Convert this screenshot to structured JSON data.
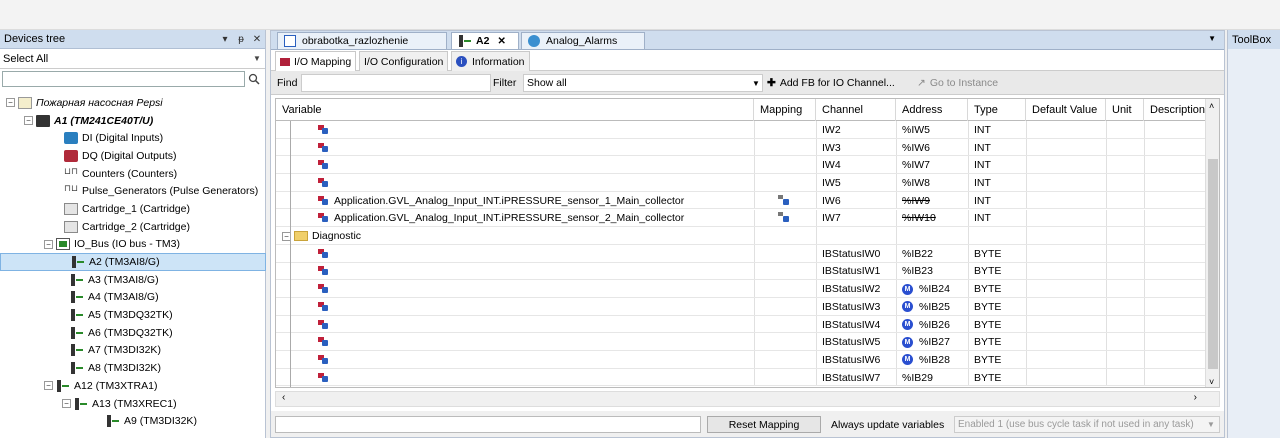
{
  "devices_panel": {
    "title": "Devices tree",
    "pin_icon": "pin-icon",
    "filter_value": "Select All",
    "tree": [
      {
        "label": "Пожарная насосная Pepsi",
        "level": 0,
        "icon": "project-icon",
        "toggle": "−"
      },
      {
        "label": "A1 (TM241CE40T/U)",
        "level": 1,
        "icon": "plc-icon",
        "toggle": "−"
      },
      {
        "label": "DI (Digital Inputs)",
        "level": 2,
        "icon": "di-icon"
      },
      {
        "label": "DQ (Digital Outputs)",
        "level": 2,
        "icon": "dq-icon"
      },
      {
        "label": "Counters (Counters)",
        "level": 2,
        "icon": "counter-icon"
      },
      {
        "label": "Pulse_Generators (Pulse Generators)",
        "level": 2,
        "icon": "pulse-icon"
      },
      {
        "label": "Cartridge_1 (Cartridge)",
        "level": 2,
        "icon": "cartridge-icon"
      },
      {
        "label": "Cartridge_2 (Cartridge)",
        "level": 2,
        "icon": "cartridge-icon"
      },
      {
        "label": "IO_Bus (IO bus - TM3)",
        "level": 2,
        "icon": "bus-icon",
        "toggle": "−"
      },
      {
        "label": "A2 (TM3AI8/G)",
        "level": 3,
        "icon": "module-icon",
        "selected": true
      },
      {
        "label": "A3 (TM3AI8/G)",
        "level": 3,
        "icon": "module-icon"
      },
      {
        "label": "A4 (TM3AI8/G)",
        "level": 3,
        "icon": "module-icon"
      },
      {
        "label": "A5 (TM3DQ32TK)",
        "level": 3,
        "icon": "module-icon"
      },
      {
        "label": "A6 (TM3DQ32TK)",
        "level": 3,
        "icon": "module-icon"
      },
      {
        "label": "A7 (TM3DI32K)",
        "level": 3,
        "icon": "module-icon"
      },
      {
        "label": "A8 (TM3DI32K)",
        "level": 3,
        "icon": "module-icon"
      },
      {
        "label": "A12 (TM3XTRA1)",
        "level": 3,
        "icon": "module-icon",
        "toggle": "−"
      },
      {
        "label": "A13 (TM3XREC1)",
        "level": 4,
        "icon": "module-icon",
        "toggle": "−"
      },
      {
        "label": "A9 (TM3DI32K)",
        "level": 5,
        "icon": "module-icon"
      }
    ]
  },
  "editor": {
    "tabs": [
      {
        "label": "obrabotka_razlozhenie",
        "active": false
      },
      {
        "label": "A2",
        "active": true,
        "close": "✕"
      },
      {
        "label": "Analog_Alarms",
        "active": false
      }
    ],
    "subtabs": [
      {
        "label": "I/O Mapping",
        "active": true
      },
      {
        "label": "I/O Configuration",
        "active": false
      },
      {
        "label": "Information",
        "active": false
      }
    ],
    "filterbar": {
      "find_label": "Find",
      "filter_label": "Filter",
      "filter_value": "Show all",
      "add_fb_label": "Add FB for IO Channel...",
      "goto_label": "Go to Instance"
    },
    "columns": [
      "Variable",
      "Mapping",
      "Channel",
      "Address",
      "Type",
      "Default Value",
      "Unit",
      "Description"
    ],
    "rows": [
      {
        "variable": "",
        "mapping": false,
        "channel": "IW2",
        "address": "%IW5",
        "type": "INT"
      },
      {
        "variable": "",
        "mapping": false,
        "channel": "IW3",
        "address": "%IW6",
        "type": "INT"
      },
      {
        "variable": "",
        "mapping": false,
        "channel": "IW4",
        "address": "%IW7",
        "type": "INT"
      },
      {
        "variable": "",
        "mapping": false,
        "channel": "IW5",
        "address": "%IW8",
        "type": "INT"
      },
      {
        "variable": "Application.GVL_Analog_Input_INT.iPRESSURE_sensor_1_Main_collector",
        "mapping": true,
        "channel": "IW6",
        "address": "%IW9",
        "strike": true,
        "type": "INT"
      },
      {
        "variable": "Application.GVL_Analog_Input_INT.iPRESSURE_sensor_2_Main_collector",
        "mapping": true,
        "channel": "IW7",
        "address": "%IW10",
        "strike": true,
        "type": "INT"
      },
      {
        "variable": "Diagnostic",
        "folder": true,
        "channel": "",
        "address": "",
        "type": ""
      },
      {
        "variable": "",
        "mapping": false,
        "channel": "IBStatusIW0",
        "address": "%IB22",
        "type": "BYTE"
      },
      {
        "variable": "",
        "mapping": false,
        "channel": "IBStatusIW1",
        "address": "%IB23",
        "type": "BYTE"
      },
      {
        "variable": "",
        "mapping": false,
        "channel": "IBStatusIW2",
        "address": "%IB24",
        "badge": true,
        "type": "BYTE"
      },
      {
        "variable": "",
        "mapping": false,
        "channel": "IBStatusIW3",
        "address": "%IB25",
        "badge": true,
        "type": "BYTE"
      },
      {
        "variable": "",
        "mapping": false,
        "channel": "IBStatusIW4",
        "address": "%IB26",
        "badge": true,
        "type": "BYTE"
      },
      {
        "variable": "",
        "mapping": false,
        "channel": "IBStatusIW5",
        "address": "%IB27",
        "badge": true,
        "type": "BYTE"
      },
      {
        "variable": "",
        "mapping": false,
        "channel": "IBStatusIW6",
        "address": "%IB28",
        "badge": true,
        "type": "BYTE"
      },
      {
        "variable": "",
        "mapping": false,
        "channel": "IBStatusIW7",
        "address": "%IB29",
        "type": "BYTE"
      }
    ],
    "badge_letter": "M",
    "bottom": {
      "reset_label": "Reset Mapping",
      "always_update_label": "Always update variables",
      "always_update_value": "Enabled 1 (use bus cycle task if not used in any task)"
    }
  },
  "toolbox": {
    "title": "ToolBox"
  }
}
